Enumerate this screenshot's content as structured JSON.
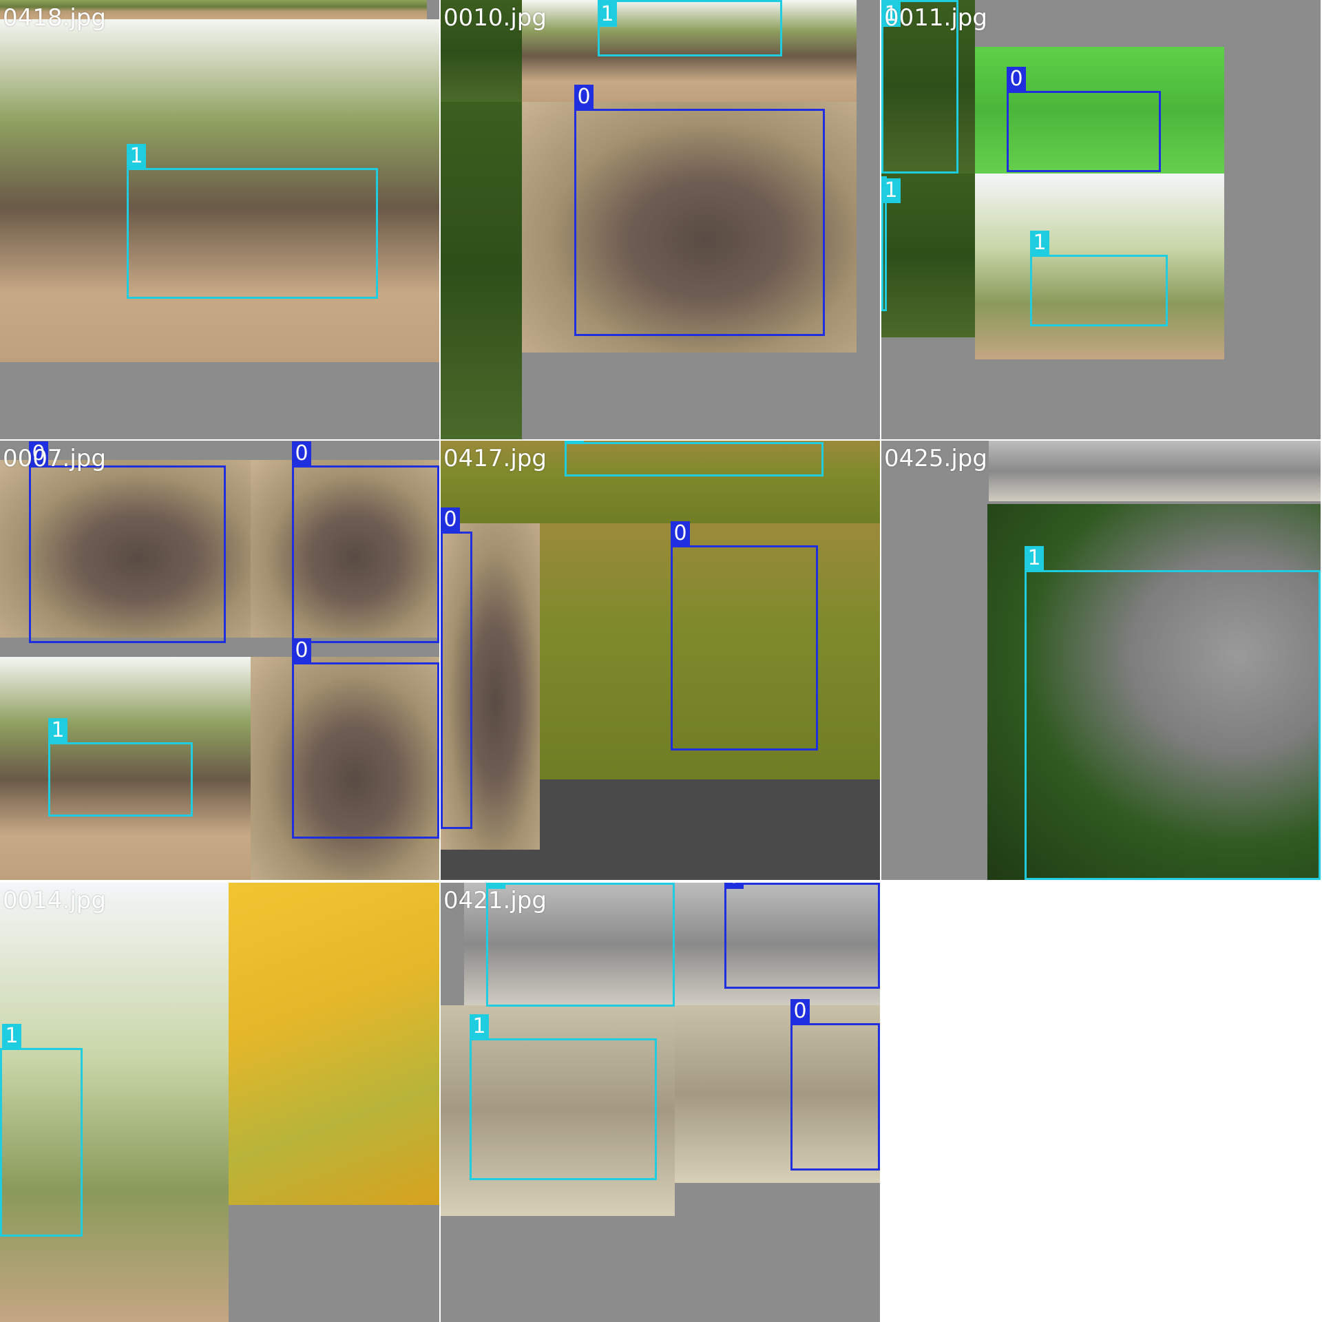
{
  "mosaic": {
    "cells": [
      {
        "title": "0418.jpg"
      },
      {
        "title": "0010.jpg"
      },
      {
        "title": "0011.jpg"
      },
      {
        "title": "0007.jpg"
      },
      {
        "title": "0417.jpg"
      },
      {
        "title": "0425.jpg"
      },
      {
        "title": "0014.jpg"
      },
      {
        "title": "0421.jpg"
      }
    ],
    "classes": {
      "buffalo": "0",
      "elephant": "1"
    },
    "colors": {
      "class_0": "#1f2fe0",
      "class_1": "#1ecde0",
      "padding": "#8c8c8c",
      "background": "#ffffff"
    }
  }
}
